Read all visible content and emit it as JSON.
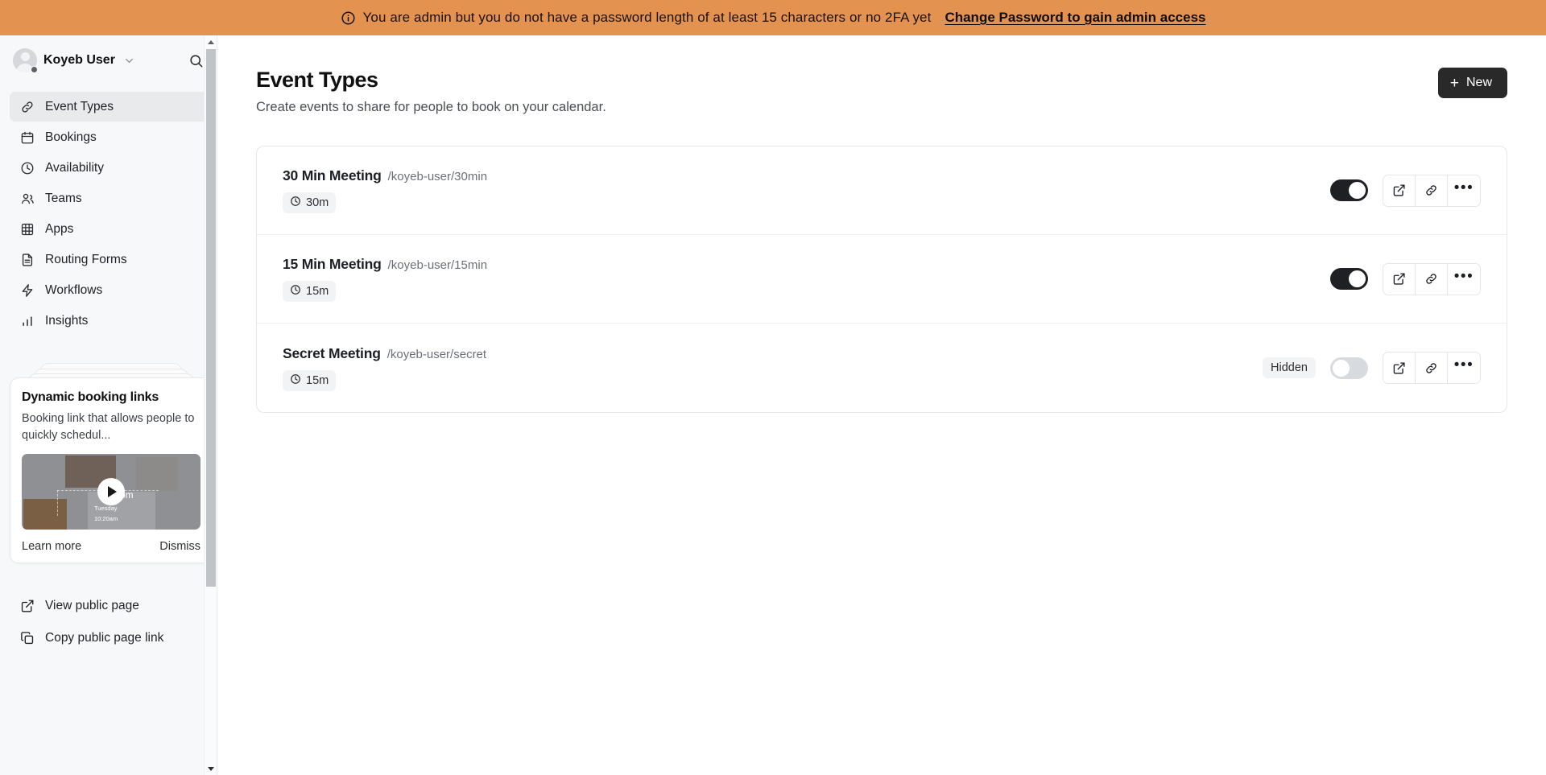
{
  "banner": {
    "icon": "info-circle-icon",
    "message": "You are admin but you do not have a password length of at least 15 characters or no 2FA yet",
    "link_label": "Change Password to gain admin access",
    "background_color": "#E49250"
  },
  "sidebar": {
    "user": {
      "name": "Koyeb User",
      "avatar_icon": "user-avatar",
      "chevron_icon": "chevron-down-icon"
    },
    "search_icon": "search-icon",
    "nav_items": [
      {
        "label": "Event Types",
        "icon": "link-icon",
        "active": true
      },
      {
        "label": "Bookings",
        "icon": "calendar-icon",
        "active": false
      },
      {
        "label": "Availability",
        "icon": "clock-icon",
        "active": false
      },
      {
        "label": "Teams",
        "icon": "users-icon",
        "active": false
      },
      {
        "label": "Apps",
        "icon": "grid-icon",
        "active": false
      },
      {
        "label": "Routing Forms",
        "icon": "document-icon",
        "active": false
      },
      {
        "label": "Workflows",
        "icon": "bolt-icon",
        "active": false
      },
      {
        "label": "Insights",
        "icon": "bar-chart-icon",
        "active": false
      }
    ],
    "promo": {
      "title": "Dynamic booking links",
      "description": "Booking link that allows people to quickly schedul...",
      "thumbnail_text_domain": "com",
      "thumbnail_day": "Tuesday",
      "thumbnail_time": "10:20am",
      "play_icon": "play-icon",
      "learn_more_label": "Learn more",
      "dismiss_label": "Dismiss"
    },
    "bottom_links": [
      {
        "label": "View public page",
        "icon": "external-link-icon"
      },
      {
        "label": "Copy public page link",
        "icon": "copy-icon"
      }
    ]
  },
  "main": {
    "title": "Event Types",
    "subtitle": "Create events to share for people to book on your calendar.",
    "new_button": {
      "label": "New",
      "icon": "plus-icon"
    },
    "events": [
      {
        "title": "30 Min Meeting",
        "slug": "/koyeb-user/30min",
        "duration": "30m",
        "duration_icon": "clock-icon",
        "hidden_label": null,
        "enabled": true,
        "actions": [
          "external-link-icon",
          "link-icon",
          "more-horizontal-icon"
        ]
      },
      {
        "title": "15 Min Meeting",
        "slug": "/koyeb-user/15min",
        "duration": "15m",
        "duration_icon": "clock-icon",
        "hidden_label": null,
        "enabled": true,
        "actions": [
          "external-link-icon",
          "link-icon",
          "more-horizontal-icon"
        ]
      },
      {
        "title": "Secret Meeting",
        "slug": "/koyeb-user/secret",
        "duration": "15m",
        "duration_icon": "clock-icon",
        "hidden_label": "Hidden",
        "enabled": false,
        "actions": [
          "external-link-icon",
          "link-icon",
          "more-horizontal-icon"
        ]
      }
    ]
  }
}
